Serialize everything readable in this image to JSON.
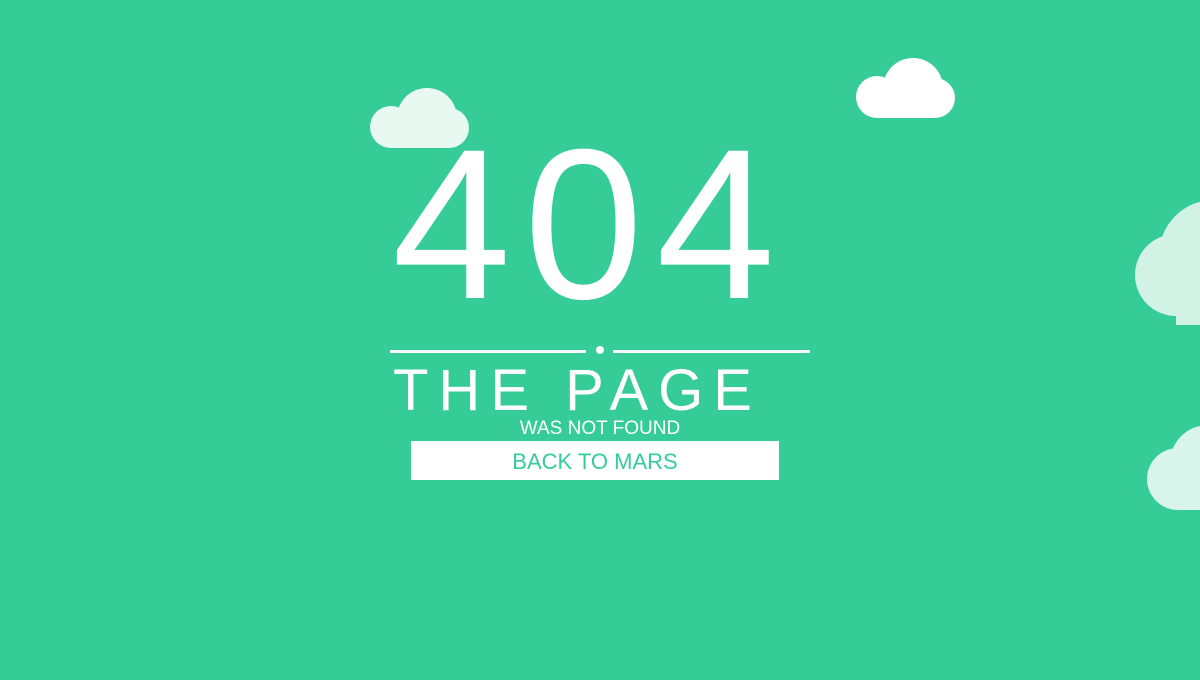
{
  "error": {
    "code": "404",
    "headline": "THE PAGE",
    "subline": "WAS NOT FOUND"
  },
  "actions": {
    "back_label": "BACK TO MARS"
  },
  "theme": {
    "background": "#35cc98",
    "foreground": "#ffffff"
  },
  "decorations": {
    "clouds": [
      "cloud-icon",
      "cloud-icon",
      "cloud-icon",
      "cloud-icon"
    ]
  }
}
